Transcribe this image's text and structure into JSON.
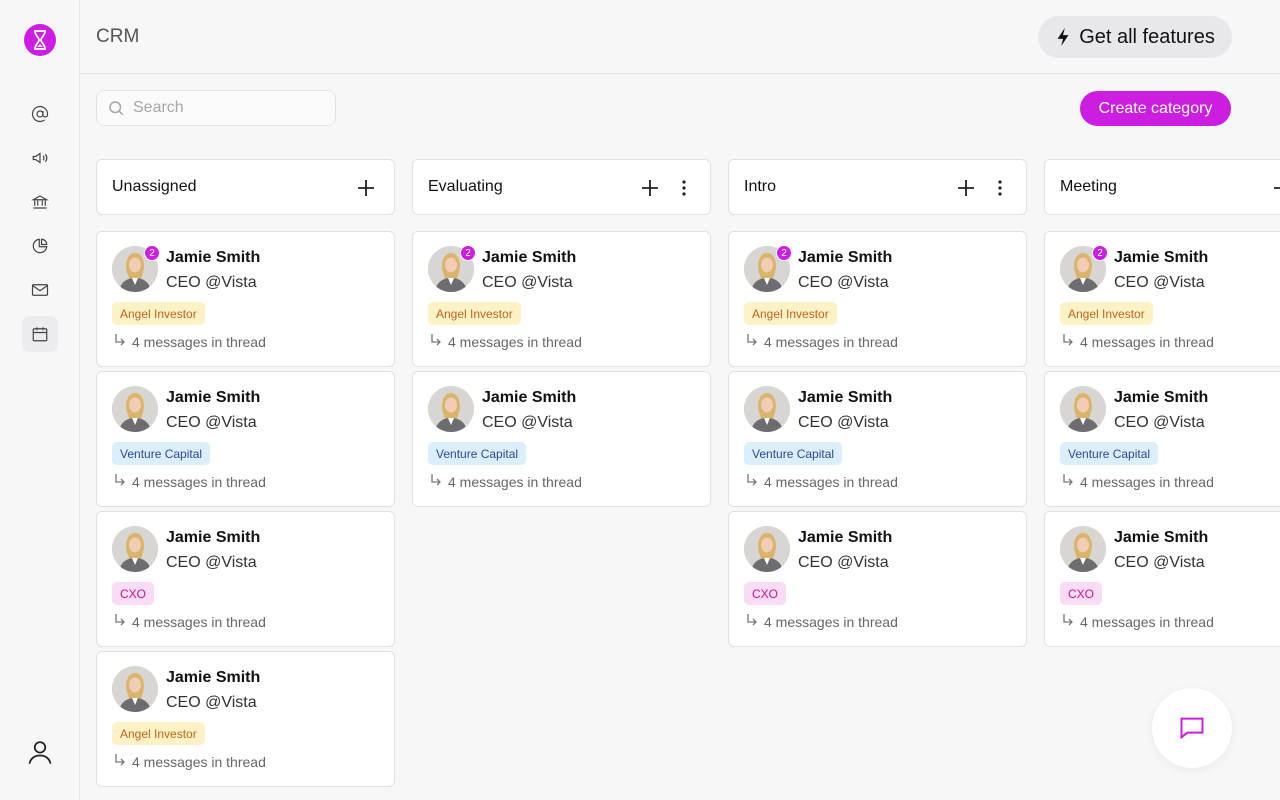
{
  "app": {
    "title": "CRM",
    "features_label": "Get all features"
  },
  "sidebar": {
    "items": [
      {
        "icon": "at-icon"
      },
      {
        "icon": "megaphone-icon"
      },
      {
        "icon": "bank-icon"
      },
      {
        "icon": "pie-chart-icon"
      },
      {
        "icon": "mail-icon"
      },
      {
        "icon": "calendar-icon",
        "active": true
      }
    ]
  },
  "search": {
    "placeholder": "Search",
    "value": ""
  },
  "create_label": "Create category",
  "colors": {
    "accent": "#cc1ee0"
  },
  "columns": [
    {
      "title": "Unassigned",
      "cards": [
        {
          "name": "Jamie Smith",
          "role": "CEO @Vista",
          "tag": "Angel Investor",
          "thread": "4 messages in thread",
          "badge": "2"
        },
        {
          "name": "Jamie Smith",
          "role": "CEO @Vista",
          "tag": "Venture Capital",
          "thread": "4 messages in thread"
        },
        {
          "name": "Jamie Smith",
          "role": "CEO @Vista",
          "tag": "CXO",
          "thread": "4 messages in thread"
        },
        {
          "name": "Jamie Smith",
          "role": "CEO @Vista",
          "tag": "Angel Investor",
          "thread": "4 messages in thread"
        }
      ]
    },
    {
      "title": "Evaluating",
      "cards": [
        {
          "name": "Jamie Smith",
          "role": "CEO @Vista",
          "tag": "Angel Investor",
          "thread": "4 messages in thread",
          "badge": "2"
        },
        {
          "name": "Jamie Smith",
          "role": "CEO @Vista",
          "tag": "Venture Capital",
          "thread": "4 messages in thread"
        }
      ]
    },
    {
      "title": "Intro",
      "cards": [
        {
          "name": "Jamie Smith",
          "role": "CEO @Vista",
          "tag": "Angel Investor",
          "thread": "4 messages in thread",
          "badge": "2"
        },
        {
          "name": "Jamie Smith",
          "role": "CEO @Vista",
          "tag": "Venture Capital",
          "thread": "4 messages in thread"
        },
        {
          "name": "Jamie Smith",
          "role": "CEO @Vista",
          "tag": "CXO",
          "thread": "4 messages in thread"
        }
      ]
    },
    {
      "title": "Meeting",
      "cards": [
        {
          "name": "Jamie Smith",
          "role": "CEO @Vista",
          "tag": "Angel Investor",
          "thread": "4 messages in thread",
          "badge": "2"
        },
        {
          "name": "Jamie Smith",
          "role": "CEO @Vista",
          "tag": "Venture Capital",
          "thread": "4 messages in thread"
        },
        {
          "name": "Jamie Smith",
          "role": "CEO @Vista",
          "tag": "CXO",
          "thread": "4 messages in thread"
        }
      ]
    }
  ]
}
